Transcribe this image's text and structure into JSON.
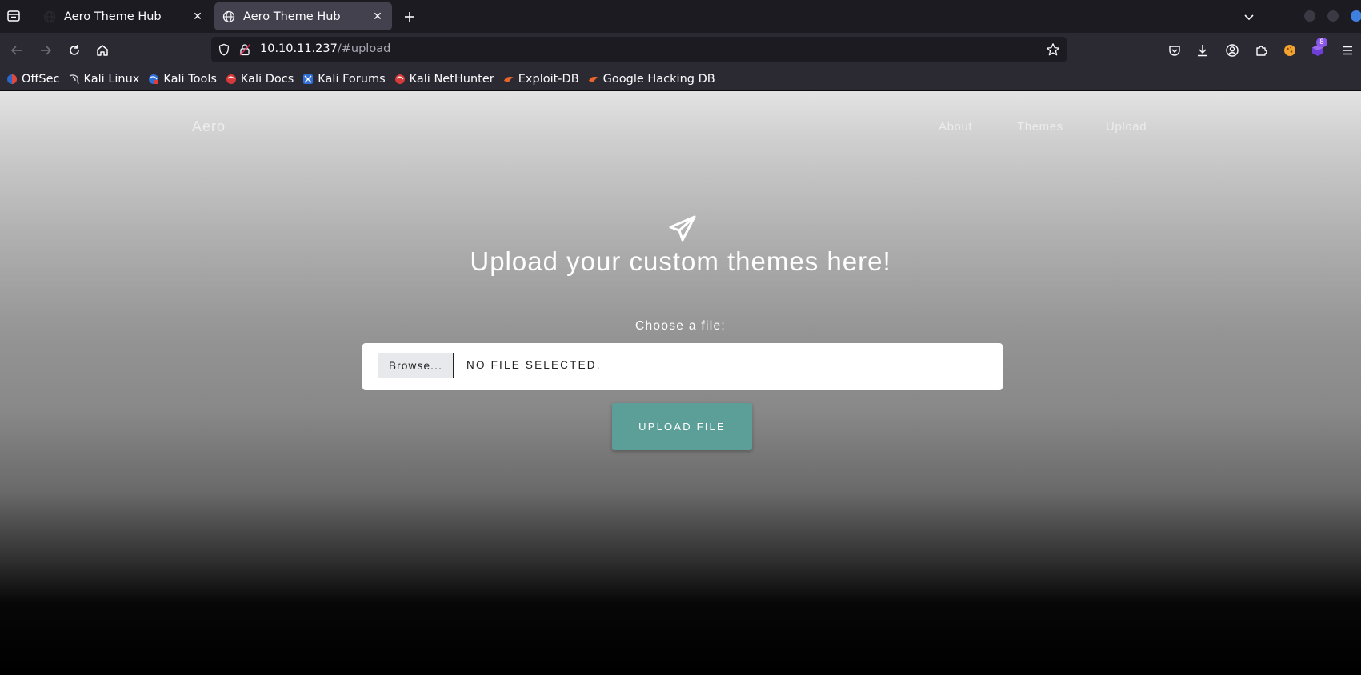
{
  "browser": {
    "tabs": [
      {
        "title": "Aero Theme Hub"
      },
      {
        "title": "Aero Theme Hub"
      }
    ],
    "url_host": "10.10.11.237",
    "url_path": "/#upload",
    "extension_badge": "8",
    "bookmarks": [
      {
        "label": "OffSec",
        "icon": "offsec-icon"
      },
      {
        "label": "Kali Linux",
        "icon": "kali-dragon-icon"
      },
      {
        "label": "Kali Tools",
        "icon": "kali-tools-icon"
      },
      {
        "label": "Kali Docs",
        "icon": "kali-docs-icon"
      },
      {
        "label": "Kali Forums",
        "icon": "kali-forums-icon"
      },
      {
        "label": "Kali NetHunter",
        "icon": "kali-nethunter-icon"
      },
      {
        "label": "Exploit-DB",
        "icon": "exploit-db-icon"
      },
      {
        "label": "Google Hacking DB",
        "icon": "ghdb-icon"
      }
    ]
  },
  "site": {
    "logo": "Aero",
    "nav": [
      "About",
      "Themes",
      "Upload"
    ],
    "hero_title": "Upload your custom themes here!",
    "choose_label": "Choose a file:",
    "browse_label": "Browse...",
    "file_status": "NO FILE SELECTED.",
    "upload_label": "UPLOAD FILE"
  },
  "colors": {
    "accent": "#5c9e98",
    "browser_bg": "#1c1b22",
    "toolbar_bg": "#2b2a33"
  }
}
